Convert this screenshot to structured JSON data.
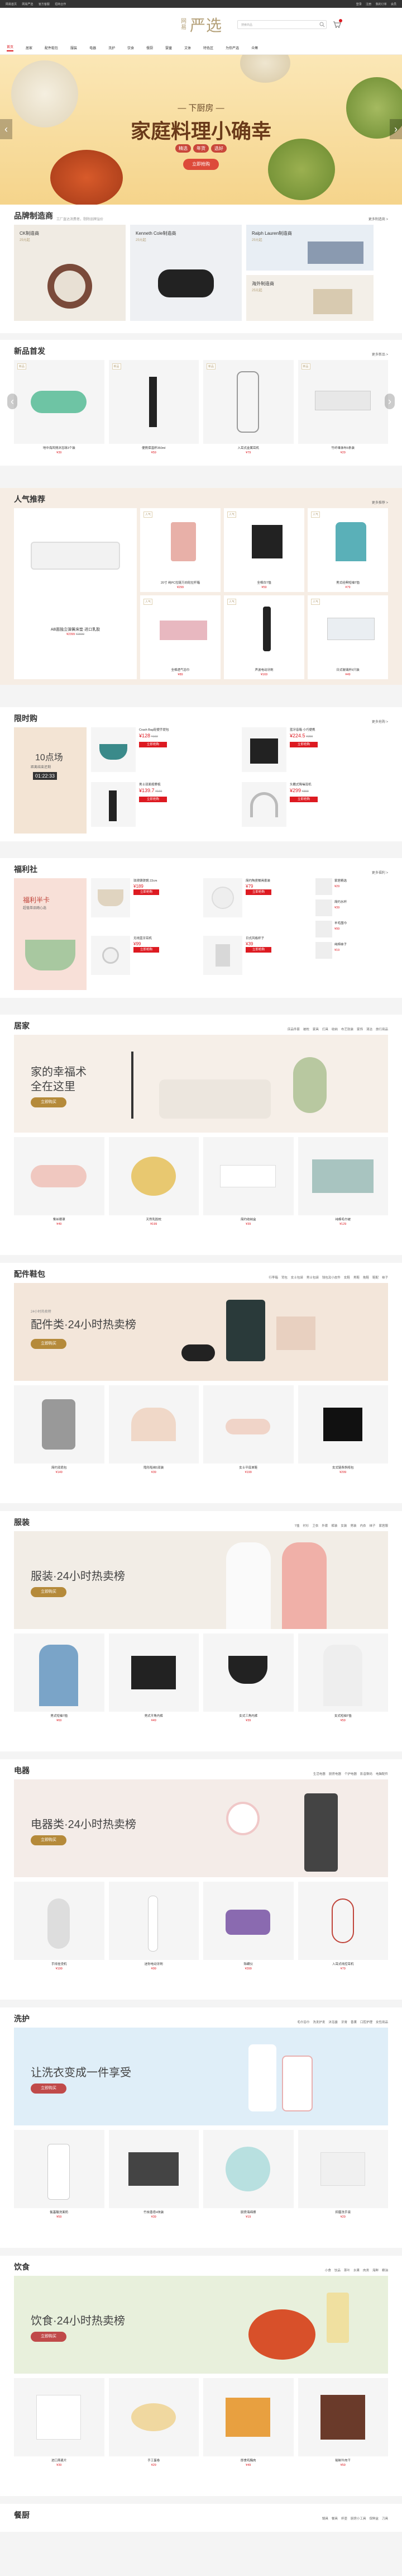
{
  "topbar": {
    "left": [
      "网易首页",
      "网易严选",
      "官方客服",
      "招商合作"
    ],
    "right": [
      "登录",
      "注册",
      "我的订单",
      "会员"
    ]
  },
  "header": {
    "logo_top": "网易",
    "logo_main": "严选",
    "search_placeholder": "搜索商品",
    "colors": {
      "brand": "#b4a078",
      "accent": "#dd1a21"
    }
  },
  "nav": {
    "items": [
      "首页",
      "居家",
      "配件鞋包",
      "服装",
      "电器",
      "洗护",
      "饮食",
      "餐厨",
      "婴童",
      "文体",
      "特色区",
      "为你严选",
      "众筹"
    ],
    "active": 0
  },
  "hero": {
    "subtitle": "— 下厨房 —",
    "title": "家庭料理小确幸",
    "tags": [
      "精选",
      "年货",
      "选好"
    ],
    "button": "立即抢购"
  },
  "brand": {
    "title": "品牌制造商",
    "subtitle": "工厂直达消费者，剔除品牌溢价",
    "more": "更多制造商 >",
    "cards": [
      {
        "name": "CK制造商",
        "price": "25元起"
      },
      {
        "name": "Kenneth Cole制造商",
        "price": "25元起"
      },
      {
        "name": "Ralph Lauren制造商",
        "price": "25元起"
      },
      {
        "name": "海外制造商",
        "price": "25元起"
      }
    ]
  },
  "newgoods": {
    "title": "新品首发",
    "more": "更多新品 >",
    "items": [
      {
        "name": "地中海风情沐浴球3个装",
        "price": "¥39"
      },
      {
        "name": "便携保温杯350ml",
        "price": "¥59"
      },
      {
        "name": "入耳式金属耳机",
        "price": "¥79"
      },
      {
        "name": "竹纤维抹布5条装",
        "price": "¥29"
      }
    ]
  },
  "popular": {
    "title": "人气推荐",
    "more": "更多推荐 >",
    "main": {
      "name": "AB面独立弹簧床垫 进口乳胶",
      "price": "¥2399",
      "old": "¥2999"
    },
    "items": [
      {
        "name": "20寸 纯PC拉链万向轮拉杆箱",
        "price": "¥299"
      },
      {
        "name": "全棉白T恤",
        "price": "¥59"
      },
      {
        "name": "男式经典短袖T恤",
        "price": "¥79"
      },
      {
        "name": "全棉透气浴巾",
        "price": "¥89"
      },
      {
        "name": "声波电动牙刷",
        "price": "¥169"
      },
      {
        "name": "日式玻璃杯6只装",
        "price": "¥49"
      }
    ]
  },
  "flash": {
    "title": "限时购",
    "more": "更多抢购 >",
    "promo": "10点场",
    "promo2": "距离结束还剩",
    "timer": "01:22:33",
    "items": [
      {
        "name": "Crash Bag轻便手提包",
        "price": "¥128",
        "old": "¥169",
        "btn": "立即抢购"
      },
      {
        "name": "蓝牙音箱 小巧便携",
        "price": "¥224.5",
        "old": "¥299",
        "btn": "立即抢购"
      },
      {
        "name": "男士双面按摩梳",
        "price": "¥139.7",
        "old": "¥169",
        "btn": "立即抢购"
      },
      {
        "name": "头戴式降噪耳机",
        "price": "¥299",
        "old": "¥399",
        "btn": "立即抢购"
      }
    ]
  },
  "welfare": {
    "title": "福利社",
    "more": "更多福利 >",
    "promo": "福利半卡",
    "promo2": "超值单品随心选",
    "items": [
      {
        "name": "珐琅铸铁锅 22cm",
        "price": "¥189",
        "btn": "立即抢购"
      },
      {
        "name": "简约陶瓷餐具套装",
        "price": "¥79",
        "btn": "立即抢购"
      },
      {
        "name": "无线蓝牙耳机",
        "price": "¥99",
        "btn": "立即抢购"
      },
      {
        "name": "日式风格杯子",
        "price": "¥39",
        "btn": "立即抢购"
      }
    ],
    "list": [
      {
        "name": "家居精选",
        "price": "¥29"
      },
      {
        "name": "简约水杯",
        "price": "¥39"
      },
      {
        "name": "羊毛围巾",
        "price": "¥99"
      },
      {
        "name": "纯棉袜子",
        "price": "¥19"
      }
    ]
  },
  "home": {
    "title": "居家",
    "links": [
      "床品件套",
      "被枕",
      "家具",
      "灯具",
      "收纳",
      "布艺软装",
      "家饰",
      "清洁",
      "旅行用品"
    ],
    "banner_title": "家的幸福术",
    "banner_title2": "全在这里",
    "banner_btn": "立即购买",
    "items": [
      {
        "name": "蚕丝眼罩",
        "price": "¥49"
      },
      {
        "name": "天然乳胶枕",
        "price": "¥199"
      },
      {
        "name": "简约收纳盒",
        "price": "¥39"
      },
      {
        "name": "纯棉毛巾被",
        "price": "¥129"
      }
    ]
  },
  "accessory": {
    "title": "配件鞋包",
    "links": [
      "行李箱",
      "背包",
      "女士包袋",
      "男士包袋",
      "钱包及小皮件",
      "女鞋",
      "男鞋",
      "拖鞋",
      "鞋配",
      "袜子"
    ],
    "banner_sub": "24小时热卖榜",
    "banner_title": "配件类·24小时热卖榜",
    "banner_btn": "立即购买",
    "items": [
      {
        "name": "简约双肩包",
        "price": "¥149"
      },
      {
        "name": "隐形船袜5双装",
        "price": "¥39"
      },
      {
        "name": "女士平底单鞋",
        "price": "¥199"
      },
      {
        "name": "女式链条斜挎包",
        "price": "¥299"
      }
    ]
  },
  "clothes": {
    "title": "服装",
    "links": [
      "T恤",
      "衬衫",
      "卫衣",
      "外套",
      "裤装",
      "女装",
      "男装",
      "内衣",
      "袜子",
      "家居服"
    ],
    "banner_title": "服装·24小时热卖榜",
    "banner_btn": "立即购买",
    "items": [
      {
        "name": "男式短袖T恤",
        "price": "¥69"
      },
      {
        "name": "男式平角内裤",
        "price": "¥49"
      },
      {
        "name": "女式三角内裤",
        "price": "¥39"
      },
      {
        "name": "女式短袖T恤",
        "price": "¥59"
      }
    ]
  },
  "electric": {
    "title": "电器",
    "links": [
      "生活电器",
      "厨房电器",
      "个护电器",
      "影音数码",
      "电脑配件"
    ],
    "banner_title": "电器类·24小时热卖榜",
    "banner_btn": "立即购买",
    "items": [
      {
        "name": "手持挂烫机",
        "price": "¥199"
      },
      {
        "name": "迷你电动牙刷",
        "price": "¥99"
      },
      {
        "name": "除螨仪",
        "price": "¥399"
      },
      {
        "name": "入耳式线控耳机",
        "price": "¥79"
      }
    ]
  },
  "wash": {
    "title": "洗护",
    "links": [
      "毛巾浴巾",
      "洗发护发",
      "沐浴露",
      "牙膏",
      "香薰",
      "口腔护理",
      "女性用品"
    ],
    "banner_title": "让洗衣变成一件享受",
    "banner_btn": "立即购买",
    "items": [
      {
        "name": "氨基酸洗面奶",
        "price": "¥59"
      },
      {
        "name": "竹炭香皂4块装",
        "price": "¥39"
      },
      {
        "name": "厨房海绵擦",
        "price": "¥19"
      },
      {
        "name": "抑菌洗手液",
        "price": "¥29"
      }
    ]
  },
  "food": {
    "title": "饮食",
    "links": [
      "小食",
      "饮品",
      "茶叶",
      "水果",
      "肉类",
      "海鲜",
      "粮油"
    ],
    "banner_title": "饮食·24小时热卖榜",
    "banner_btn": "立即购买",
    "items": [
      {
        "name": "进口燕麦片",
        "price": "¥39"
      },
      {
        "name": "手工蛋卷",
        "price": "¥29"
      },
      {
        "name": "即食鸡胸肉",
        "price": "¥49"
      },
      {
        "name": "秘制牛肉干",
        "price": "¥59"
      }
    ]
  },
  "kitchen": {
    "title": "餐厨",
    "links": [
      "锅具",
      "餐具",
      "杯壶",
      "厨房小工具",
      "保鲜盒",
      "刀具"
    ]
  }
}
